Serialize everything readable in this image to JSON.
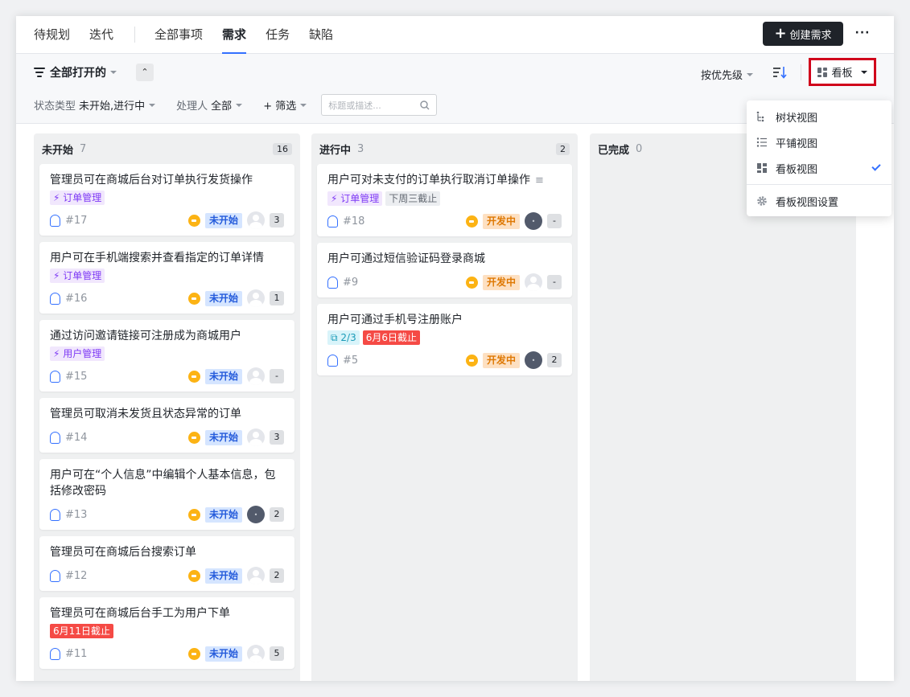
{
  "nav": {
    "tabs": [
      {
        "label": "待规划"
      },
      {
        "label": "迭代"
      },
      {
        "label": "全部事项"
      },
      {
        "label": "需求"
      },
      {
        "label": "任务"
      },
      {
        "label": "缺陷"
      }
    ],
    "create_label": "创建需求",
    "more_label": "···"
  },
  "filter": {
    "view_label": "全部打开的",
    "status_type_label": "状态类型",
    "status_type_value": "未开始,进行中",
    "assignee_label": "处理人",
    "assignee_value": "全部",
    "filter_label": "+ 筛选",
    "search_placeholder": "标题或描述...",
    "sort_label": "按优先级",
    "board_label": "看板"
  },
  "dropdown": {
    "items": [
      {
        "label": "树状视图",
        "icon": "tree-icon"
      },
      {
        "label": "平铺视图",
        "icon": "list-icon"
      },
      {
        "label": "看板视图",
        "icon": "board-icon",
        "selected": true
      },
      {
        "label": "看板视图设置",
        "icon": "gear-icon"
      }
    ]
  },
  "columns": [
    {
      "name": "未开始",
      "count": "7",
      "badge": "16",
      "cards": [
        {
          "title": "管理员可在商城后台对订单执行发货操作",
          "tags": [
            {
              "text": "订单管理",
              "kind": "purple",
              "bolt": true
            }
          ],
          "num": "#17",
          "status": "未开始",
          "status_kind": "blue",
          "avatar": "default",
          "sub": "3"
        },
        {
          "title": "用户可在手机端搜索并查看指定的订单详情",
          "tags": [
            {
              "text": "订单管理",
              "kind": "purple",
              "bolt": true
            }
          ],
          "num": "#16",
          "status": "未开始",
          "status_kind": "blue",
          "avatar": "default",
          "sub": "1"
        },
        {
          "title": "通过访问邀请链接可注册成为商城用户",
          "tags": [
            {
              "text": "用户管理",
              "kind": "purple",
              "bolt": true
            }
          ],
          "num": "#15",
          "status": "未开始",
          "status_kind": "blue",
          "avatar": "default",
          "sub": "-"
        },
        {
          "title": "管理员可取消未发货且状态异常的订单",
          "tags": [],
          "num": "#14",
          "status": "未开始",
          "status_kind": "blue",
          "avatar": "default",
          "sub": "3"
        },
        {
          "title": "用户可在“个人信息”中编辑个人基本信息，包括修改密码",
          "tags": [],
          "num": "#13",
          "status": "未开始",
          "status_kind": "blue",
          "avatar": "dark",
          "sub": "2"
        },
        {
          "title": "管理员可在商城后台搜索订单",
          "tags": [],
          "num": "#12",
          "status": "未开始",
          "status_kind": "blue",
          "avatar": "default",
          "sub": "2"
        },
        {
          "title": "管理员可在商城后台手工为用户下单",
          "tags": [
            {
              "text": "6月11日截止",
              "kind": "red"
            }
          ],
          "num": "#11",
          "status": "未开始",
          "status_kind": "blue",
          "avatar": "default",
          "sub": "5"
        }
      ]
    },
    {
      "name": "进行中",
      "count": "3",
      "badge": "2",
      "cards": [
        {
          "title": "用户可对未支付的订单执行取消订单操作",
          "has_desc": true,
          "tags": [
            {
              "text": "订单管理",
              "kind": "purple",
              "bolt": true
            },
            {
              "text": "下周三截止",
              "kind": "gray"
            }
          ],
          "num": "#18",
          "status": "开发中",
          "status_kind": "orange",
          "avatar": "dark",
          "sub": "-"
        },
        {
          "title": "用户可通过短信验证码登录商城",
          "tags": [],
          "num": "#9",
          "status": "开发中",
          "status_kind": "orange",
          "avatar": "default",
          "sub": "-"
        },
        {
          "title": "用户可通过手机号注册账户",
          "tags": [
            {
              "text": "2/3",
              "kind": "cyan",
              "subtask": true
            },
            {
              "text": "6月6日截止",
              "kind": "red"
            }
          ],
          "num": "#5",
          "status": "开发中",
          "status_kind": "orange",
          "avatar": "dark",
          "sub": "2"
        }
      ]
    },
    {
      "name": "已完成",
      "count": "0",
      "badge": "",
      "cards": []
    }
  ]
}
